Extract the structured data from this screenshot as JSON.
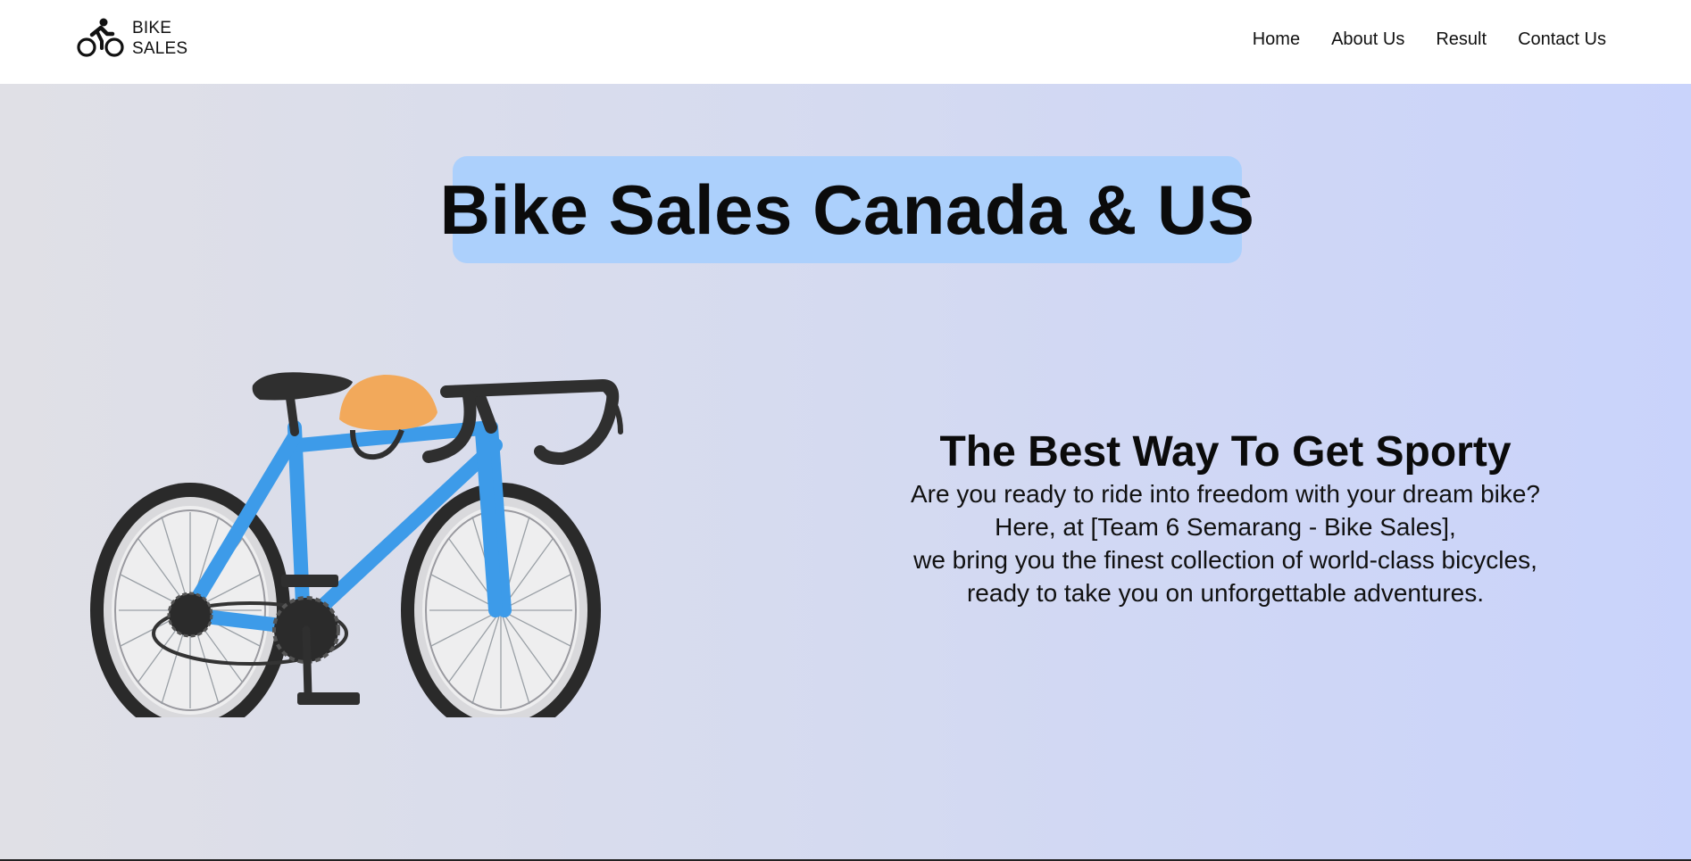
{
  "header": {
    "brand": {
      "line1": "BIKE",
      "line2": "SALES",
      "icon": "cyclist-icon"
    },
    "nav": [
      {
        "label": "Home"
      },
      {
        "label": "About Us"
      },
      {
        "label": "Result"
      },
      {
        "label": "Contact Us"
      }
    ]
  },
  "hero": {
    "headline": "Bike Sales Canada & US",
    "image_icon": "road-bike-illustration",
    "tagline_title": "The Best Way To Get Sporty",
    "tagline_lines": [
      "Are you ready to ride into freedom with your dream bike?",
      "Here, at [Team 6 Semarang - Bike Sales],",
      "we bring you the finest collection of world-class bicycles,",
      "ready to take you on unforgettable adventures."
    ]
  },
  "colors": {
    "headline_bg": "#acd0fc",
    "hero_gradient_start": "#e0e0e6",
    "hero_gradient_end": "#c9d3fb",
    "bike_frame": "#3d9be9",
    "helmet": "#f2a95b"
  }
}
